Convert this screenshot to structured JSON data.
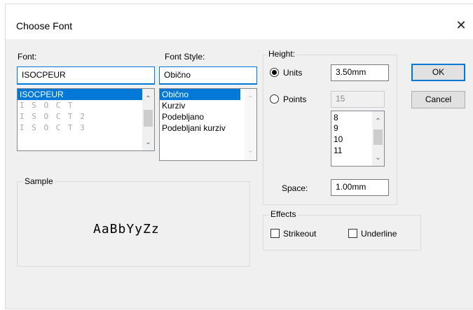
{
  "dialog": {
    "title": "Choose Font",
    "close_glyph": "✕"
  },
  "font": {
    "label": "Font:",
    "value": "ISOCPEUR",
    "items": [
      "ISOCPEUR",
      "I S O C T",
      "I S O C T 2",
      "I S O C T 3"
    ],
    "selected_index": 0
  },
  "font_style": {
    "label": "Font Style:",
    "value": "Običnо",
    "items": [
      "Običnо",
      "Kurziv",
      "Podebljano",
      "Podebljani kurziv"
    ],
    "selected_index": 0
  },
  "height": {
    "group_label": "Height:",
    "units_label": "Units",
    "units_value": "3.50mm",
    "units_selected": true,
    "points_label": "Points",
    "points_value": "15",
    "points_items": [
      "8",
      "9",
      "10",
      "11"
    ],
    "space_label": "Space:",
    "space_value": "1.00mm"
  },
  "buttons": {
    "ok": "OK",
    "cancel": "Cancel"
  },
  "sample": {
    "group_label": "Sample",
    "text": "AaBbYyZz"
  },
  "effects": {
    "group_label": "Effects",
    "strikeout_label": "Strikeout",
    "strikeout_checked": false,
    "underline_label": "Underline",
    "underline_checked": false
  },
  "icons": {
    "scroll_up": "chevron-up-icon",
    "scroll_down": "chevron-down-icon",
    "close": "close-icon"
  },
  "colors": {
    "selection": "#0078d7",
    "dialog_bg": "#f0f0f0"
  }
}
